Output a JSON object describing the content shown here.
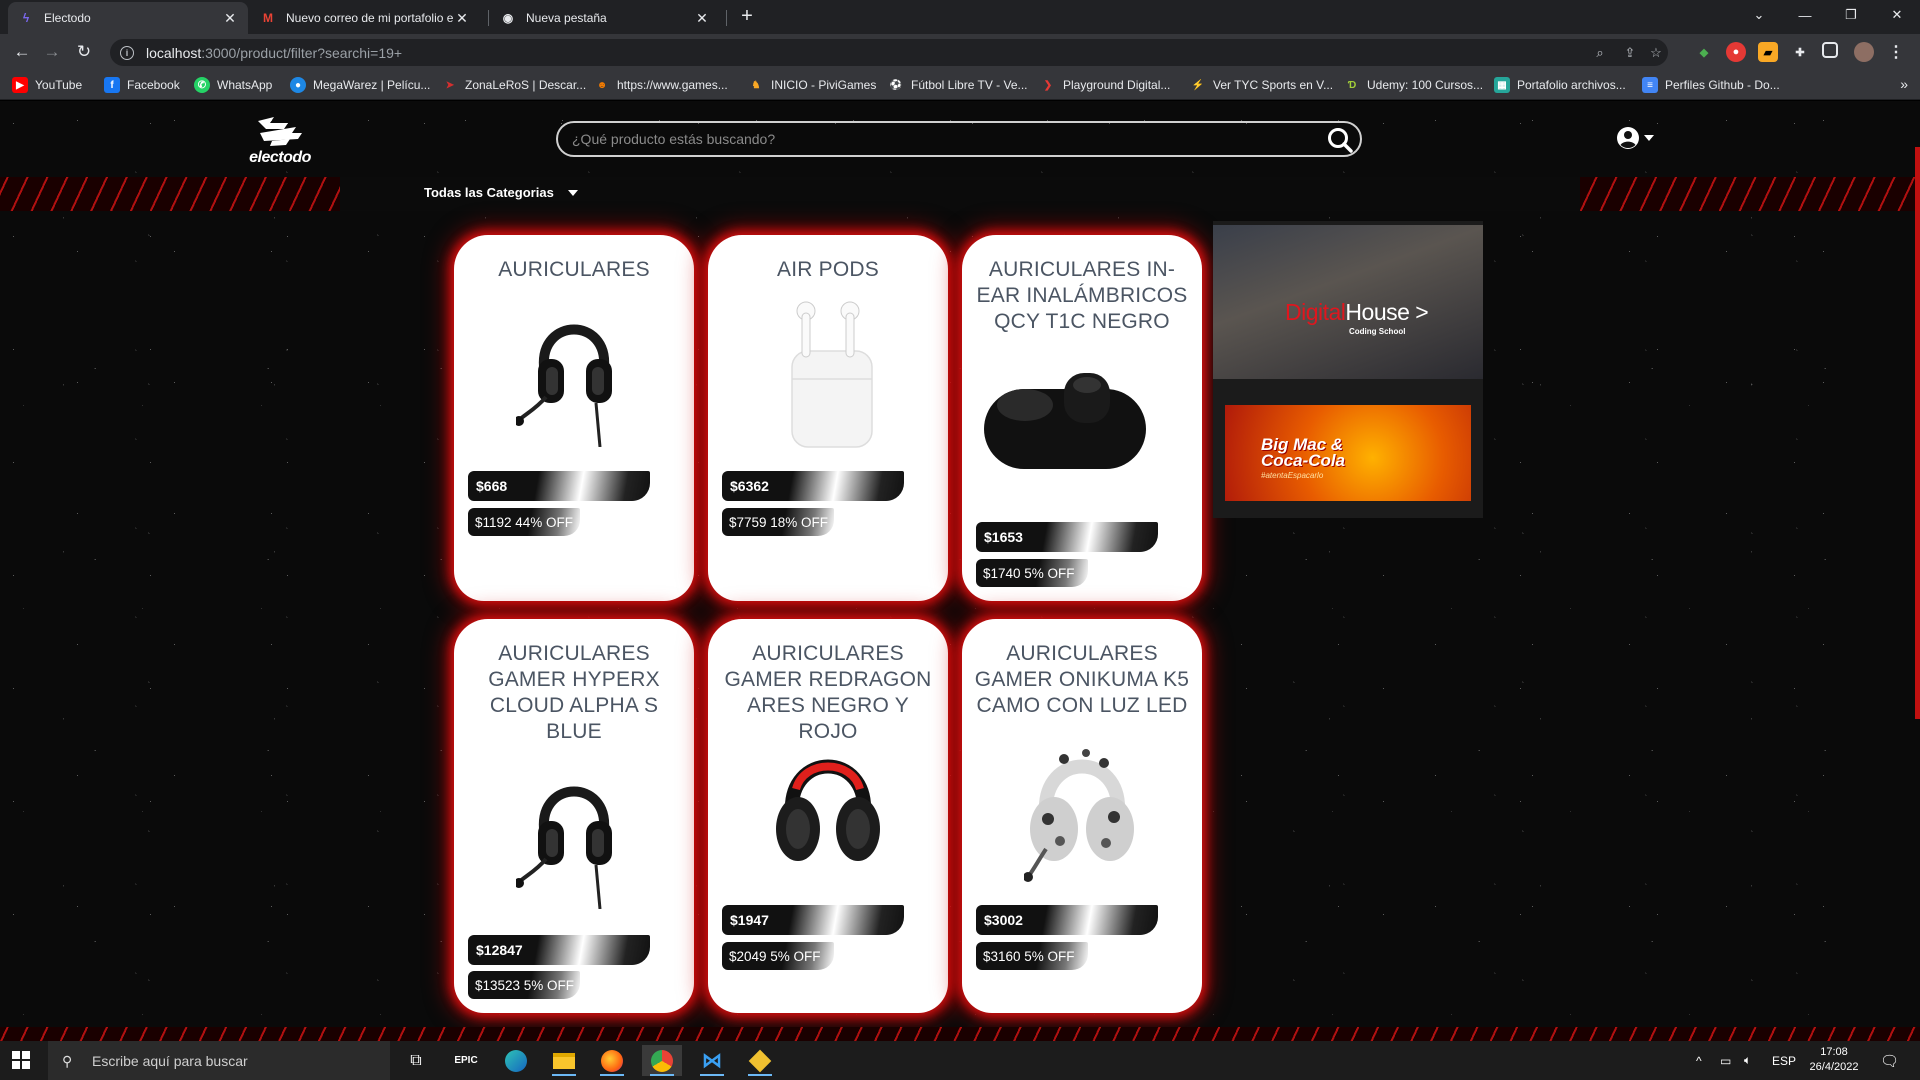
{
  "browser": {
    "tabs": [
      {
        "title": "Electodo",
        "active": true
      },
      {
        "title": "Nuevo correo de mi portafolio e",
        "active": false
      },
      {
        "title": "Nueva pestaña",
        "active": false
      }
    ],
    "url_host": "localhost",
    "url_rest": ":3000/product/filter?searchi=19+",
    "bookmarks": [
      {
        "label": "YouTube",
        "icon": "youtube-icon",
        "color": "#ff0000"
      },
      {
        "label": "Facebook",
        "icon": "facebook-icon",
        "color": "#1877f2"
      },
      {
        "label": "WhatsApp",
        "icon": "whatsapp-icon",
        "color": "#25d366"
      },
      {
        "label": "MegaWarez | Pelícu...",
        "icon": "megawarez-icon",
        "color": "#1e88e5"
      },
      {
        "label": "ZonaLeRoS | Descar...",
        "icon": "zonaleros-icon",
        "color": "#d32f2f"
      },
      {
        "label": "https://www.games...",
        "icon": "games-icon",
        "color": "#f57c00"
      },
      {
        "label": "INICIO - PiviGames",
        "icon": "pivigames-icon",
        "color": "#f9a825"
      },
      {
        "label": "Fútbol Libre TV - Ve...",
        "icon": "football-icon",
        "color": "#9e9e9e"
      },
      {
        "label": "Playground Digital...",
        "icon": "playground-icon",
        "color": "#e53935"
      },
      {
        "label": "Ver TYC Sports en V...",
        "icon": "tyc-icon",
        "color": "#fbc02d"
      },
      {
        "label": "Udemy: 100 Cursos...",
        "icon": "udemy-icon",
        "color": "#a3d039"
      },
      {
        "label": "Portafolio archivos...",
        "icon": "portfolio-icon",
        "color": "#26a69a"
      },
      {
        "label": "Perfiles Github - Do...",
        "icon": "docs-icon",
        "color": "#4285f4"
      }
    ]
  },
  "site": {
    "logo_text": "electodo",
    "search_placeholder": "¿Qué producto estás buscando?",
    "category_label": "Todas las Categorias"
  },
  "products": [
    {
      "name": "AURICULARES",
      "price": "$668",
      "old_price": "$1192 44% OFF",
      "image": "headset-black"
    },
    {
      "name": "AIR PODS",
      "price": "$6362",
      "old_price": "$7759 18% OFF",
      "image": "airpods"
    },
    {
      "name": "AURICULARES IN-EAR INALÁMBRICOS QCY T1C NEGRO",
      "price": "$1653",
      "old_price": "$1740 5% OFF",
      "image": "earbuds-case"
    },
    {
      "name": "AURICULARES GAMER HYPERX CLOUD ALPHA S BLUE",
      "price": "$12847",
      "old_price": "$13523 5% OFF",
      "image": "headset-black"
    },
    {
      "name": "AURICULARES GAMER REDRAGON ARES NEGRO Y ROJO",
      "price": "$1947",
      "old_price": "$2049 5% OFF",
      "image": "headset-red"
    },
    {
      "name": "AURICULARES GAMER ONIKUMA K5 CAMO CON LUZ LED",
      "price": "$3002",
      "old_price": "$3160 5% OFF",
      "image": "headset-camo"
    }
  ],
  "ads": {
    "digitalhouse_red": "Digital",
    "digitalhouse_white": "House >",
    "digitalhouse_sub": "Coding School",
    "mcdonalds_line1": "Big Mac &",
    "mcdonalds_line2": "Coca-Cola",
    "mcdonalds_sub": "#atentaEspacarlo"
  },
  "taskbar": {
    "search_placeholder": "Escribe aquí para buscar",
    "language": "ESP",
    "time": "17:08",
    "date": "26/4/2022",
    "apps": [
      "task-view-icon",
      "epic-games-icon",
      "edge-icon",
      "file-explorer-icon",
      "firefox-icon",
      "chrome-icon",
      "vscode-icon",
      "git-icon"
    ]
  },
  "colors": {
    "accent": "#d01010",
    "card_bg": "#ffffff",
    "card_text": "#4b5563"
  }
}
